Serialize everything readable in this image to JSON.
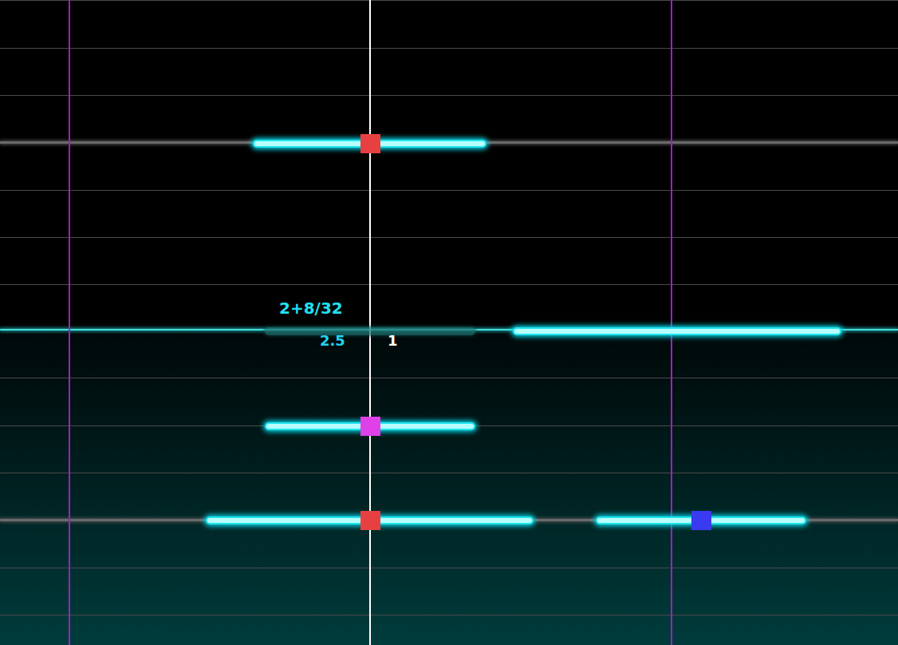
{
  "editor": {
    "beat_label": "2+8/32",
    "values": [
      {
        "text": "2.5",
        "color": "#22d3ee"
      },
      {
        "text": "1",
        "color": "#ffffff"
      }
    ]
  },
  "notes": [
    {
      "kind": "note"
    },
    {
      "kind": "ghost"
    },
    {
      "kind": "note"
    },
    {
      "kind": "note"
    },
    {
      "kind": "note"
    },
    {
      "kind": "note"
    }
  ],
  "markers": [
    {
      "color": "#e84040"
    },
    {
      "color": "#e040e8"
    },
    {
      "color": "#e84040"
    },
    {
      "color": "#3a3af0"
    }
  ]
}
